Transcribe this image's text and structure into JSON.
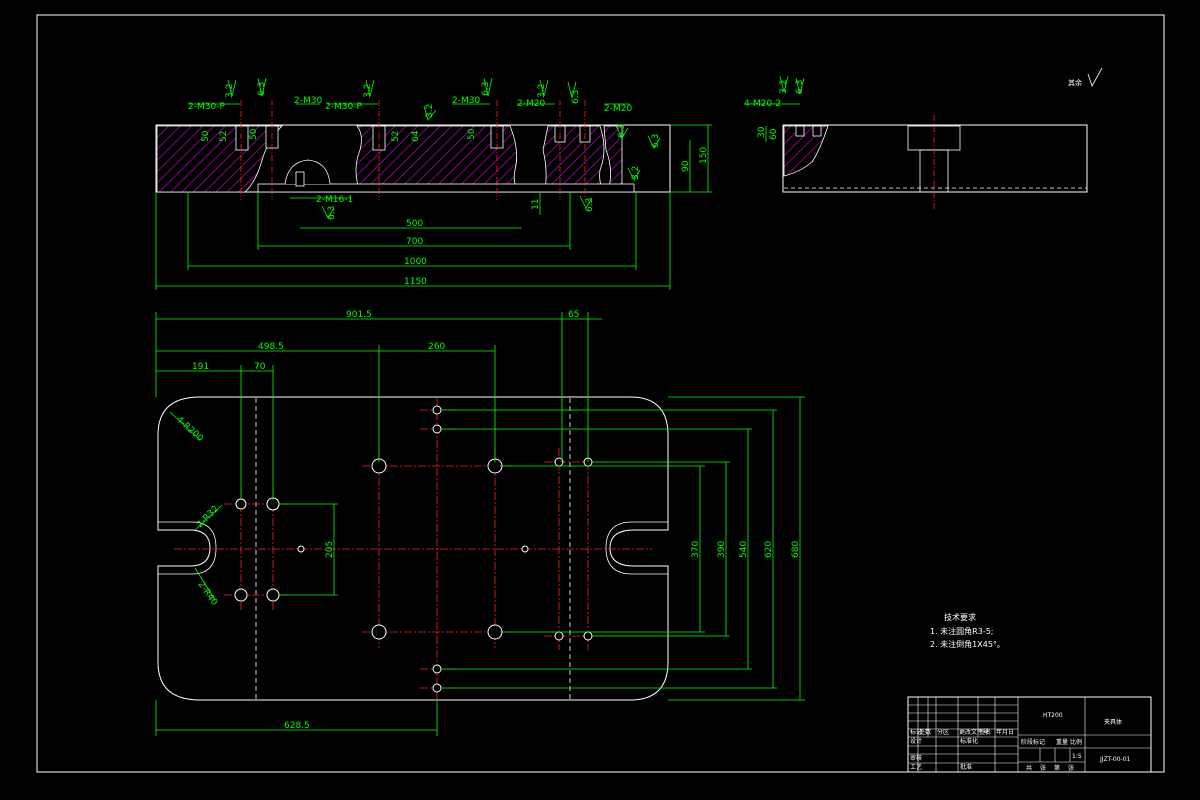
{
  "side_view": {
    "callouts": [
      "2-M30-P",
      "2-M30",
      "2-M30-P",
      "2-M30",
      "2-M20",
      "2-M20",
      "2-M16-1"
    ],
    "dims_h": [
      "500",
      "700",
      "1000",
      "1150"
    ],
    "dims_v": [
      "50",
      "52",
      "50",
      "52",
      "64",
      "50",
      "150",
      "90",
      "11"
    ],
    "roughness": [
      "3.2",
      "6.3",
      "3.2",
      "6.3",
      "3.2",
      "6.3",
      "3.2",
      "6.3",
      "6.3",
      "3.2",
      "6.3",
      "6.3"
    ]
  },
  "right_view": {
    "callout": "4-M20-2",
    "dims_v": [
      "30",
      "60"
    ],
    "roughness": [
      "3.2",
      "6.3"
    ],
    "general_roughness_label": "其余"
  },
  "plan_view": {
    "top_dims": [
      "901.5",
      "65",
      "498.5",
      "260",
      "191",
      "70"
    ],
    "bottom_dim": "628.5",
    "right_dims": [
      "370",
      "390",
      "540",
      "620",
      "680"
    ],
    "inner_dim": "205",
    "radius_labels": [
      "4-R200",
      "2-R32",
      "2-R40"
    ]
  },
  "tech_notes": {
    "title": "技术要求",
    "items": [
      "1. 未注圆角R3-5;",
      "2. 未注倒角1X45°。"
    ]
  },
  "title_block": {
    "material": "HT200",
    "part_name": "夹具体",
    "drawing_no": "JJZT-00-01",
    "row_labels": [
      "标记",
      "处数",
      "分区",
      "更改文件号",
      "签名",
      "年月日"
    ],
    "left_labels": [
      "设计",
      "审核",
      "工艺"
    ],
    "mid_labels": [
      "标准化",
      "批准"
    ],
    "stage_labels": [
      "阶段标记",
      "重量",
      "比例"
    ],
    "scale": "1:5",
    "sheet_labels": [
      "共",
      "张",
      "第",
      "张"
    ]
  }
}
